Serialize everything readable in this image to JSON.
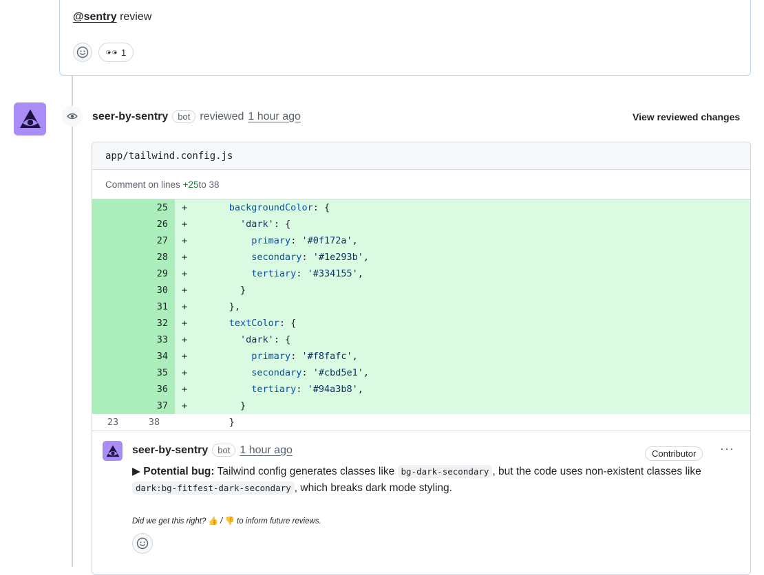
{
  "previous_comment": {
    "mention": "@sentry",
    "text": " review",
    "reaction_count": "1"
  },
  "review": {
    "author": "seer-by-sentry",
    "bot_label": "bot",
    "action": "reviewed",
    "time": "1 hour ago",
    "view_changes": "View reviewed changes"
  },
  "file": {
    "path": "app/tailwind.config.js",
    "comment_lines_prefix": "Comment on lines ",
    "comment_lines_start": "+25",
    "comment_lines_mid": " to ",
    "comment_lines_end": "38"
  },
  "diff_lines": [
    {
      "old": "",
      "new": "25",
      "sign": "+",
      "indent": "      ",
      "prop": "backgroundColor",
      "rest": ": {"
    },
    {
      "old": "",
      "new": "26",
      "sign": "+",
      "indent": "        ",
      "prop": "",
      "str": "'dark'",
      "rest": ": {"
    },
    {
      "old": "",
      "new": "27",
      "sign": "+",
      "indent": "          ",
      "prop": "primary",
      "rest": ": ",
      "str2": "'#0f172a'",
      "tail": ","
    },
    {
      "old": "",
      "new": "28",
      "sign": "+",
      "indent": "          ",
      "prop": "secondary",
      "rest": ": ",
      "str2": "'#1e293b'",
      "tail": ","
    },
    {
      "old": "",
      "new": "29",
      "sign": "+",
      "indent": "          ",
      "prop": "tertiary",
      "rest": ": ",
      "str2": "'#334155'",
      "tail": ","
    },
    {
      "old": "",
      "new": "30",
      "sign": "+",
      "indent": "        ",
      "prop": "",
      "rest": "}"
    },
    {
      "old": "",
      "new": "31",
      "sign": "+",
      "indent": "      ",
      "prop": "",
      "rest": "},"
    },
    {
      "old": "",
      "new": "32",
      "sign": "+",
      "indent": "      ",
      "prop": "textColor",
      "rest": ": {"
    },
    {
      "old": "",
      "new": "33",
      "sign": "+",
      "indent": "        ",
      "prop": "",
      "str": "'dark'",
      "rest": ": {"
    },
    {
      "old": "",
      "new": "34",
      "sign": "+",
      "indent": "          ",
      "prop": "primary",
      "rest": ": ",
      "str2": "'#f8fafc'",
      "tail": ","
    },
    {
      "old": "",
      "new": "35",
      "sign": "+",
      "indent": "          ",
      "prop": "secondary",
      "rest": ": ",
      "str2": "'#cbd5e1'",
      "tail": ","
    },
    {
      "old": "",
      "new": "36",
      "sign": "+",
      "indent": "          ",
      "prop": "tertiary",
      "rest": ": ",
      "str2": "'#94a3b8'",
      "tail": ","
    },
    {
      "old": "",
      "new": "37",
      "sign": "+",
      "indent": "        ",
      "prop": "",
      "rest": "}"
    },
    {
      "old": "23",
      "new": "38",
      "sign": "",
      "indent": "      ",
      "prop": "",
      "rest": "}"
    }
  ],
  "review_comment": {
    "author": "seer-by-sentry",
    "bot_label": "bot",
    "time": "1 hour ago",
    "role": "Contributor",
    "more": "···",
    "marker": "▶ ",
    "title": "Potential bug:",
    "body_1": " Tailwind config generates classes like ",
    "code_1": "bg-dark-secondary",
    "body_2": ", but the code uses non-existent classes like ",
    "code_2": "dark:bg-fitfest-dark-secondary",
    "body_3": ", which breaks dark mode styling.",
    "feedback_prefix": "Did we get this right? ",
    "thumbs_up": "👍",
    "feedback_sep": " / ",
    "thumbs_down": "👎",
    "feedback_suffix": " to inform future reviews."
  },
  "colors": {
    "added_bg": "#dafbe1",
    "added_gutter": "#aceebb",
    "avatar_bg": "#a98cf6",
    "code_keyword": "#0550ae",
    "code_string": "#0a3069"
  }
}
